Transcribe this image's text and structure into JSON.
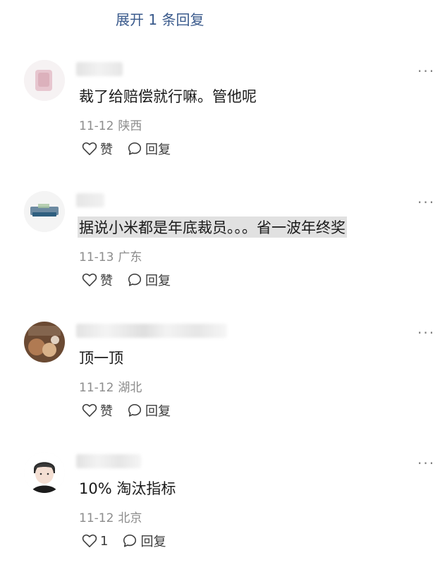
{
  "header": {
    "expand_replies": "展开 1 条回复"
  },
  "comments": [
    {
      "text": "裁了给赔偿就行嘛。管他呢",
      "date": "11-12",
      "location": "陕西",
      "like_label": "赞",
      "reply_label": "回复",
      "more_label": "···"
    },
    {
      "text": "据说小米都是年底裁员。。。省一波年终奖",
      "date": "11-13",
      "location": "广东",
      "like_label": "赞",
      "reply_label": "回复",
      "more_label": "···"
    },
    {
      "text": "顶一顶",
      "date": "11-12",
      "location": "湖北",
      "like_label": "赞",
      "reply_label": "回复",
      "more_label": "···"
    },
    {
      "text": "10% 淘汰指标",
      "date": "11-12",
      "location": "北京",
      "like_label": "1",
      "reply_label": "回复",
      "more_label": "···"
    }
  ]
}
